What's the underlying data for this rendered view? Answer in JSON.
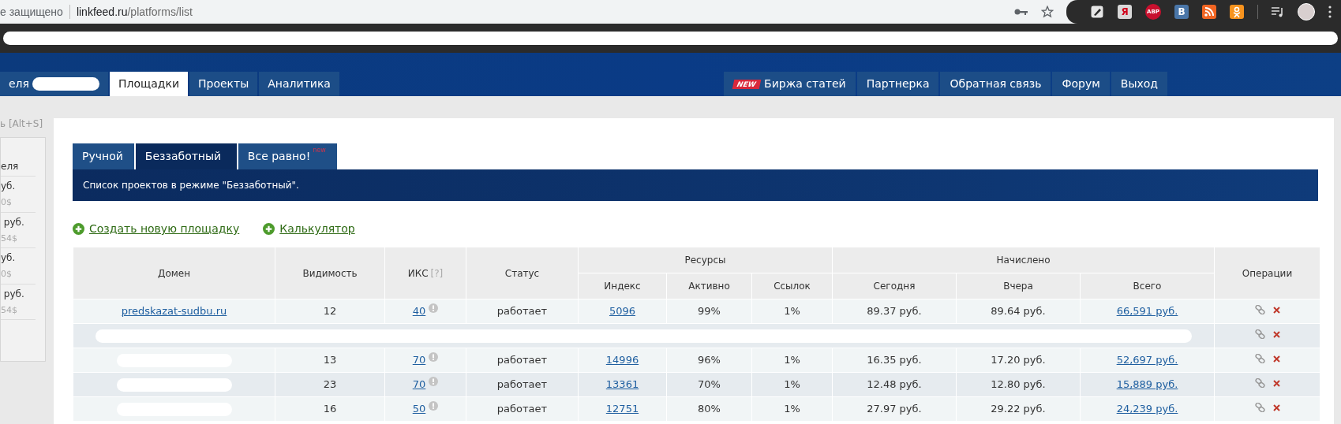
{
  "browser": {
    "security": "е защищено",
    "url_host": "linkfeed.ru",
    "url_path": "/platforms/list",
    "extensions": [
      {
        "kind": "pen"
      },
      {
        "kind": "yandex",
        "glyph": "Я"
      },
      {
        "kind": "octagon",
        "glyph": "ABP"
      },
      {
        "kind": "vk",
        "glyph": "В"
      },
      {
        "kind": "rss"
      },
      {
        "kind": "figure"
      }
    ]
  },
  "nav": {
    "left": [
      {
        "label": "еля",
        "selected": false,
        "masked": true
      },
      {
        "label": "Площадки",
        "selected": true
      },
      {
        "label": "Проекты",
        "selected": false
      },
      {
        "label": "Аналитика",
        "selected": false
      }
    ],
    "right": [
      {
        "label": "Биржа статей",
        "badge": "NEW"
      },
      {
        "label": "Партнерка"
      },
      {
        "label": "Обратная связь"
      },
      {
        "label": "Форум"
      },
      {
        "label": "Выход"
      }
    ]
  },
  "sidebar": {
    "hotkey": "ь [Alt+S]",
    "items": [
      {
        "label": "еля"
      },
      {
        "label": "уб.",
        "sub": "0$"
      },
      {
        "label": " руб.",
        "sub": "54$"
      },
      {
        "label": "уб.",
        "sub": "0$"
      },
      {
        "label": " руб.",
        "sub": "54$"
      }
    ]
  },
  "mode_tabs": [
    {
      "label": "Ручной",
      "selected": false
    },
    {
      "label": "Беззаботный",
      "selected": true
    },
    {
      "label": "Все равно!",
      "badge": "new",
      "selected": false
    }
  ],
  "banner": "Список проектов в режиме \"Беззаботный\".",
  "actions": [
    "Создать новую площадку",
    "Калькулятор"
  ],
  "table": {
    "columns": [
      {
        "label": "Домен"
      },
      {
        "label": "Видимость"
      },
      {
        "label": "ИКС",
        "hint": "[?]"
      },
      {
        "label": "Статус"
      },
      {
        "group": "Ресурсы",
        "children": [
          "Индекс",
          "Активно",
          "Ссылок"
        ]
      },
      {
        "group": "Начислено",
        "children": [
          "Сегодня",
          "Вчера",
          "Всего"
        ]
      },
      {
        "label": "Операции"
      }
    ],
    "rows": [
      {
        "kind": "full",
        "domain": "predskazat-sudbu.ru",
        "visibility": "12",
        "iks": "40",
        "status": "работает",
        "index": "5096",
        "active": "99%",
        "links": "1%",
        "today": "89.37 руб.",
        "yesterday": "89.64 руб.",
        "total": "66,591 руб."
      },
      {
        "kind": "masked"
      },
      {
        "kind": "full",
        "visibility": "13",
        "iks": "70",
        "status": "работает",
        "index": "14996",
        "active": "96%",
        "links": "1%",
        "today": "16.35 руб.",
        "yesterday": "17.20 руб.",
        "total": "52,697 руб."
      },
      {
        "kind": "full",
        "visibility": "23",
        "iks": "70",
        "status": "работает",
        "index": "13361",
        "active": "70%",
        "links": "1%",
        "today": "12.48 руб.",
        "yesterday": "12.80 руб.",
        "total": "15,889 руб."
      },
      {
        "kind": "full",
        "visibility": "16",
        "iks": "50",
        "status": "работает",
        "index": "12751",
        "active": "80%",
        "links": "1%",
        "today": "27.97 руб.",
        "yesterday": "29.22 руб.",
        "total": "24,239 руб."
      }
    ]
  }
}
